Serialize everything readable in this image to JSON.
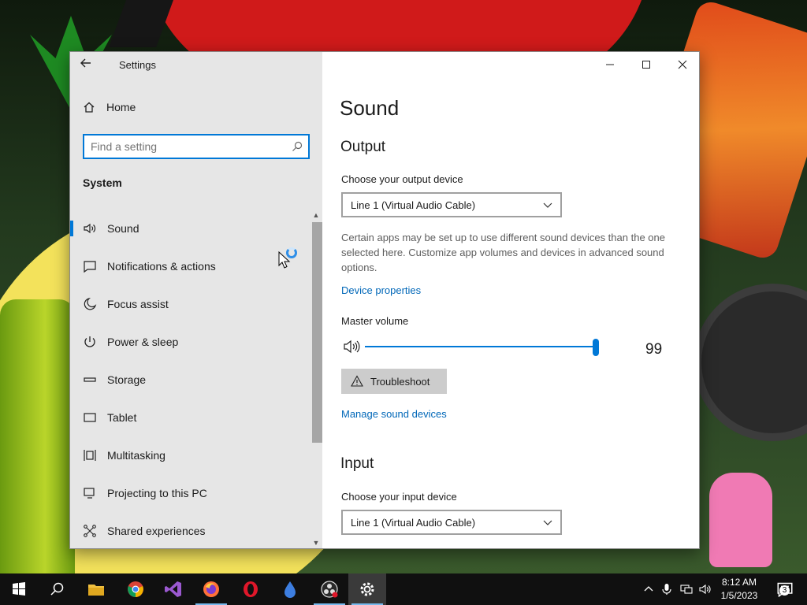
{
  "window": {
    "title": "Settings"
  },
  "sidebar": {
    "home_label": "Home",
    "search_placeholder": "Find a setting",
    "section_label": "System",
    "items": [
      {
        "label": "Sound",
        "icon": "speaker-icon",
        "selected": true
      },
      {
        "label": "Notifications & actions",
        "icon": "notifications-icon"
      },
      {
        "label": "Focus assist",
        "icon": "moon-icon"
      },
      {
        "label": "Power & sleep",
        "icon": "power-icon"
      },
      {
        "label": "Storage",
        "icon": "storage-icon"
      },
      {
        "label": "Tablet",
        "icon": "tablet-icon"
      },
      {
        "label": "Multitasking",
        "icon": "multitasking-icon"
      },
      {
        "label": "Projecting to this PC",
        "icon": "projecting-icon"
      },
      {
        "label": "Shared experiences",
        "icon": "shared-experiences-icon"
      }
    ]
  },
  "main": {
    "page_title": "Sound",
    "output": {
      "heading": "Output",
      "device_label": "Choose your output device",
      "device_value": "Line 1 (Virtual Audio Cable)",
      "description": "Certain apps may be set up to use different sound devices than the one selected here. Customize app volumes and devices in advanced sound options.",
      "device_properties_link": "Device properties",
      "master_volume_label": "Master volume",
      "master_volume_value": 99,
      "master_volume_text": "99",
      "troubleshoot_label": "Troubleshoot",
      "manage_devices_link": "Manage sound devices"
    },
    "input": {
      "heading": "Input",
      "device_label": "Choose your input device",
      "device_value": "Line 1 (Virtual Audio Cable)"
    }
  },
  "taskbar": {
    "apps": [
      "start-icon",
      "search-icon",
      "file-explorer-icon",
      "chrome-icon",
      "visual-studio-icon",
      "firefox-icon",
      "opera-icon",
      "app-icon",
      "obs-icon",
      "settings-icon"
    ],
    "clock_time": "8:12 AM",
    "clock_date": "1/5/2023",
    "notification_count": "3"
  },
  "colors": {
    "accent": "#0078d7",
    "link": "#0067b8",
    "sidebar_bg": "#e6e6e6"
  }
}
